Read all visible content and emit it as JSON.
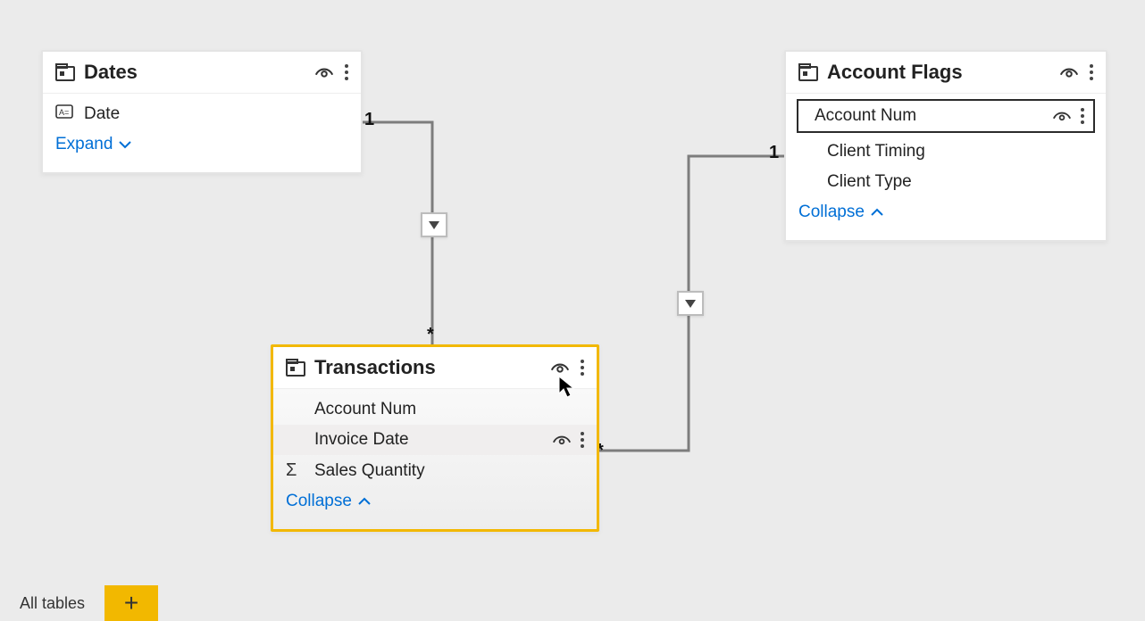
{
  "tables": {
    "dates": {
      "name": "Dates",
      "fields": {
        "date": "Date"
      },
      "toggle": "Expand"
    },
    "accountFlags": {
      "name": "Account Flags",
      "fields": {
        "accountNum": "Account Num",
        "clientTiming": "Client Timing",
        "clientType": "Client Type"
      },
      "toggle": "Collapse"
    },
    "transactions": {
      "name": "Transactions",
      "fields": {
        "accountNum": "Account Num",
        "invoiceDate": "Invoice Date",
        "salesQuantity": "Sales Quantity"
      },
      "toggle": "Collapse"
    }
  },
  "relations": {
    "datesToTransactions": {
      "fromCard": "1",
      "toCard": "*"
    },
    "accountFlagsToTransactions": {
      "fromCard": "1",
      "toCard": "*"
    }
  },
  "footer": {
    "allTables": "All tables",
    "add": "+"
  },
  "glyphs": {
    "sigma": "Σ"
  }
}
